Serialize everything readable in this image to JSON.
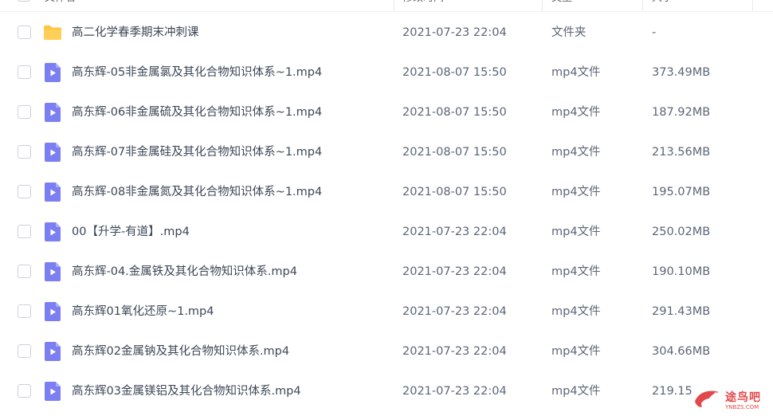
{
  "columns": {
    "name": "文件名",
    "date": "修改时间",
    "type": "类型",
    "size": "大小"
  },
  "colors": {
    "folder": "#ffc53d",
    "video": "#7b7ff2",
    "watermark": "#e2484a"
  },
  "files": [
    {
      "name": "高二化学春季期末冲刺课",
      "date": "2021-07-23 22:04",
      "type": "文件夹",
      "size": "-",
      "icon": "folder-icon"
    },
    {
      "name": "高东辉-05非金属氯及其化合物知识体系~1.mp4",
      "date": "2021-08-07 15:50",
      "type": "mp4文件",
      "size": "373.49MB",
      "icon": "video-file-icon"
    },
    {
      "name": "高东辉-06非金属硫及其化合物知识体系~1.mp4",
      "date": "2021-08-07 15:50",
      "type": "mp4文件",
      "size": "187.92MB",
      "icon": "video-file-icon"
    },
    {
      "name": "高东辉-07非金属硅及其化合物知识体系~1.mp4",
      "date": "2021-08-07 15:50",
      "type": "mp4文件",
      "size": "213.56MB",
      "icon": "video-file-icon"
    },
    {
      "name": "高东辉-08非金属氮及其化合物知识体系~1.mp4",
      "date": "2021-08-07 15:50",
      "type": "mp4文件",
      "size": "195.07MB",
      "icon": "video-file-icon"
    },
    {
      "name": "00【升学-有道】.mp4",
      "date": "2021-07-23 22:04",
      "type": "mp4文件",
      "size": "250.02MB",
      "icon": "video-file-icon"
    },
    {
      "name": "高东辉-04.金属铁及其化合物知识体系.mp4",
      "date": "2021-07-23 22:04",
      "type": "mp4文件",
      "size": "190.10MB",
      "icon": "video-file-icon"
    },
    {
      "name": "高东辉01氧化还原~1.mp4",
      "date": "2021-07-23 22:04",
      "type": "mp4文件",
      "size": "291.43MB",
      "icon": "video-file-icon"
    },
    {
      "name": "高东辉02金属钠及其化合物知识体系.mp4",
      "date": "2021-07-23 22:04",
      "type": "mp4文件",
      "size": "304.66MB",
      "icon": "video-file-icon"
    },
    {
      "name": "高东辉03金属镁铝及其化合物知识体系.mp4",
      "date": "2021-07-23 22:04",
      "type": "mp4文件",
      "size": "219.15",
      "icon": "video-file-icon"
    }
  ],
  "watermark": {
    "text": "途鸟吧",
    "sub": "YNBZS.COM"
  }
}
